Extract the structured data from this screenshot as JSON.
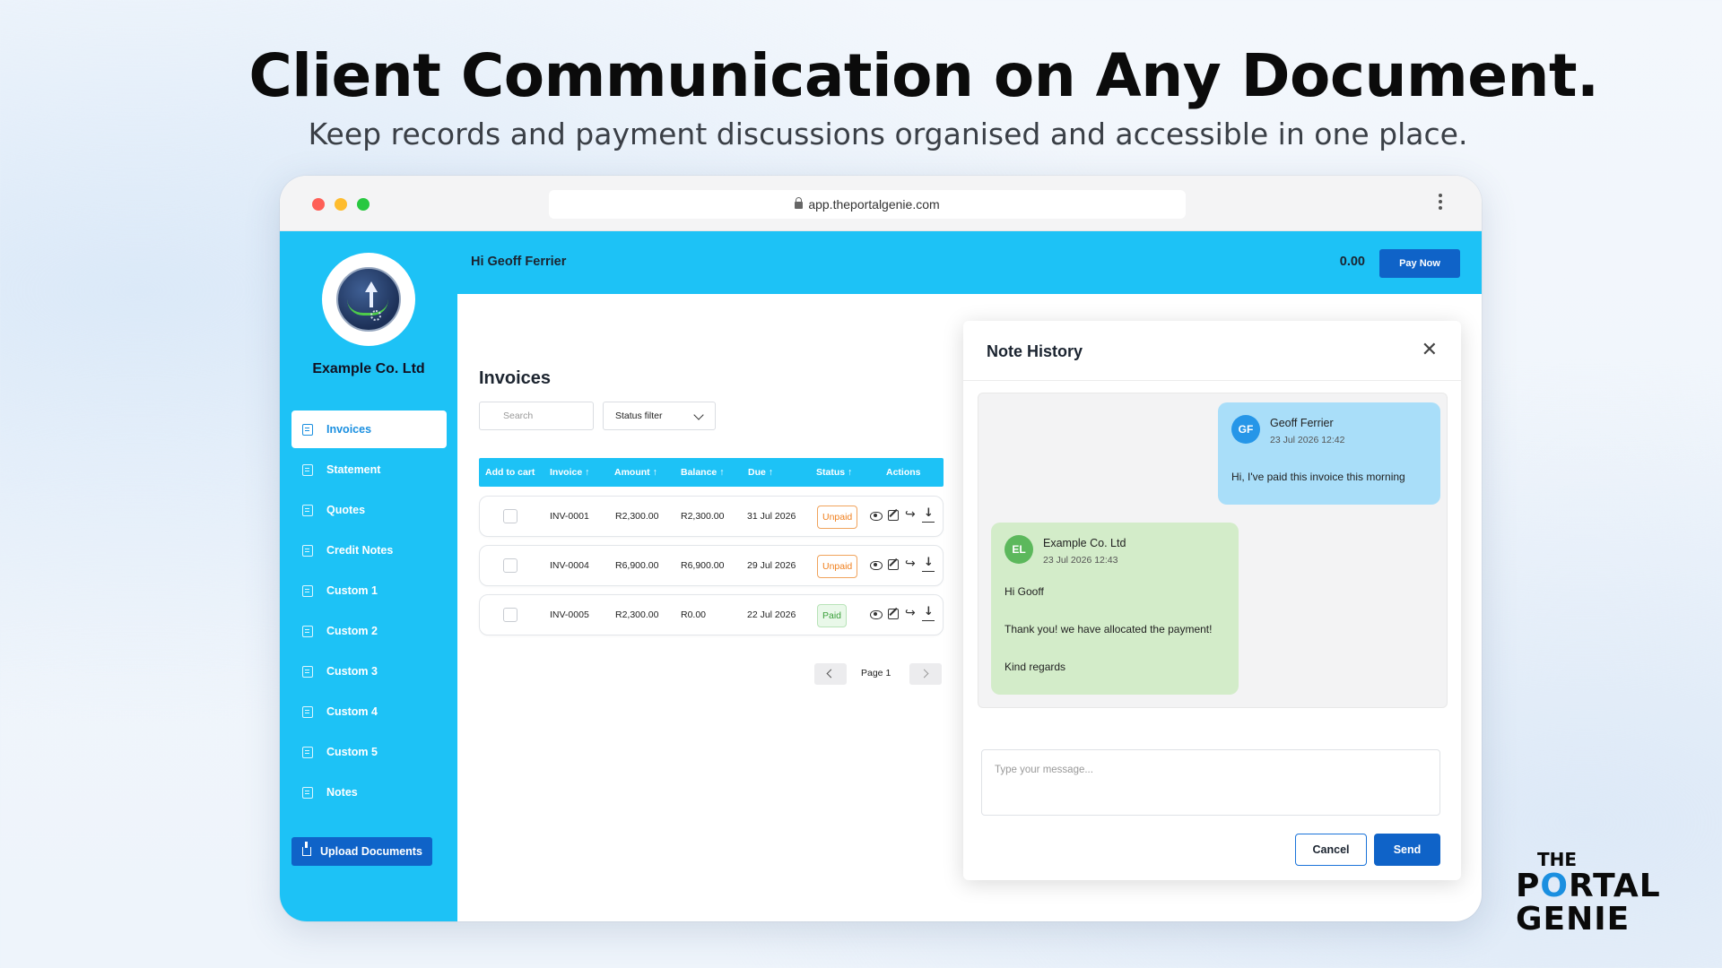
{
  "hero": {
    "title": "Client Communication on Any Document.",
    "subtitle": "Keep records and payment discussions organised and accessible in one place."
  },
  "browser": {
    "url": "app.theportalgenie.com"
  },
  "sidebar": {
    "company_name": "Example Co. Ltd",
    "items": [
      {
        "label": "Invoices"
      },
      {
        "label": "Statement"
      },
      {
        "label": "Quotes"
      },
      {
        "label": "Credit Notes"
      },
      {
        "label": "Custom 1"
      },
      {
        "label": "Custom 2"
      },
      {
        "label": "Custom 3"
      },
      {
        "label": "Custom 4"
      },
      {
        "label": "Custom 5"
      },
      {
        "label": "Notes"
      }
    ],
    "upload_label": "Upload Documents"
  },
  "topbar": {
    "greeting": "Hi Geoff Ferrier",
    "balance": "0.00",
    "pay_label": "Pay Now"
  },
  "invoices": {
    "title": "Invoices",
    "search_placeholder": "Search",
    "status_filter": "Status filter",
    "columns": [
      "Add to cart",
      "Invoice ↑",
      "Amount ↑",
      "Balance ↑",
      "Due ↑",
      "Status ↑",
      "Actions"
    ],
    "rows": [
      {
        "invoice": "INV-0001",
        "amount": "R2,300.00",
        "balance": "R2,300.00",
        "due": "31 Jul 2026",
        "status": "Unpaid"
      },
      {
        "invoice": "INV-0004",
        "amount": "R6,900.00",
        "balance": "R6,900.00",
        "due": "29 Jul 2026",
        "status": "Unpaid"
      },
      {
        "invoice": "INV-0005",
        "amount": "R2,300.00",
        "balance": "R0.00",
        "due": "22 Jul 2026",
        "status": "Paid"
      }
    ],
    "page_label": "Page 1"
  },
  "note_history": {
    "title": "Note History",
    "messages": [
      {
        "initials": "GF",
        "author": "Geoff Ferrier",
        "time": "23 Jul 2026 12:42",
        "lines": [
          "Hi, I've paid this invoice this morning"
        ]
      },
      {
        "initials": "EL",
        "author": "Example Co. Ltd",
        "time": "23 Jul 2026 12:43",
        "lines": [
          "Hi Gooff",
          "Thank you! we have allocated the payment!",
          "Kind regards"
        ]
      }
    ],
    "input_placeholder": "Type your message...",
    "cancel_label": "Cancel",
    "send_label": "Send"
  },
  "brand": {
    "line1": "THE",
    "line2_a": "P",
    "line2_o": "O",
    "line2_b": "RTAL",
    "line3": "GENIE"
  },
  "colors": {
    "accent": "#1dc2f6",
    "primary_button": "#0f63c8",
    "unpaid": "#f07f1c",
    "paid": "#3aa03a"
  }
}
